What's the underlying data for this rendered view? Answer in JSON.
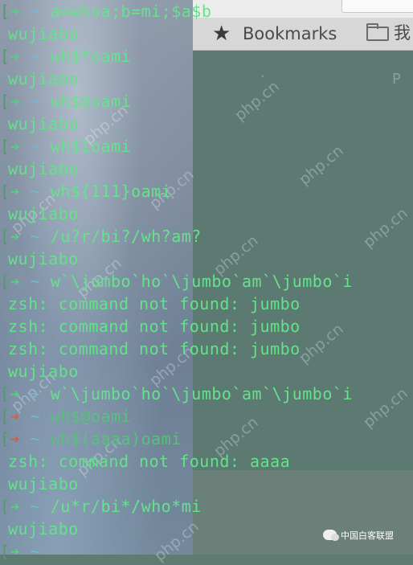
{
  "browser": {
    "bookmarks_label": "Bookmarks",
    "folder_label": "我"
  },
  "watermark": "php.cn",
  "badge": "中国白客联盟",
  "colors": {
    "prompt_arrow_ok": "#57d27a",
    "prompt_arrow_error": "#d35d4a",
    "tilde": "#6fb9d8",
    "output": "#63e28a"
  },
  "terminal": {
    "lines": [
      {
        "kind": "prompt",
        "status": "ok",
        "cmd": "a=whoa;b=mi;$a$b"
      },
      {
        "kind": "output",
        "text": "wujiabo"
      },
      {
        "kind": "prompt",
        "status": "ok",
        "cmd": "wh$*oami"
      },
      {
        "kind": "output",
        "text": "wujiabo"
      },
      {
        "kind": "prompt",
        "status": "ok",
        "cmd": "wh$@oami"
      },
      {
        "kind": "output",
        "text": "wujiabo"
      },
      {
        "kind": "prompt",
        "status": "ok",
        "cmd": "wh$1oami"
      },
      {
        "kind": "output",
        "text": "wujiabo"
      },
      {
        "kind": "prompt",
        "status": "ok",
        "cmd": "wh${111}oami"
      },
      {
        "kind": "output",
        "text": "wujiabo"
      },
      {
        "kind": "prompt",
        "status": "ok",
        "cmd": "/u?r/bi?/wh?am?"
      },
      {
        "kind": "output",
        "text": "wujiabo"
      },
      {
        "kind": "prompt",
        "status": "ok",
        "cmd": "w`\\jumbo`ho`\\jumbo`am`\\jumbo`i"
      },
      {
        "kind": "output",
        "text": "zsh: command not found: jumbo"
      },
      {
        "kind": "output",
        "text": "zsh: command not found: jumbo"
      },
      {
        "kind": "output",
        "text": "zsh: command not found: jumbo"
      },
      {
        "kind": "output",
        "text": "wujiabo"
      },
      {
        "kind": "prompt",
        "status": "ok",
        "cmd": "w`\\jumbo`ho`\\jumbo`am`\\jumbo`i"
      },
      {
        "kind": "prompt",
        "status": "error",
        "cmd": "wh$@oami"
      },
      {
        "kind": "prompt",
        "status": "error",
        "cmd": "wh$(aaaa)oami"
      },
      {
        "kind": "output",
        "text": "zsh: command not found: aaaa"
      },
      {
        "kind": "output",
        "text": "wujiabo"
      },
      {
        "kind": "prompt",
        "status": "ok",
        "cmd": "/u*r/bi*/who*mi"
      },
      {
        "kind": "output",
        "text": "wujiabo"
      },
      {
        "kind": "prompt",
        "status": "ok",
        "cmd": ""
      }
    ]
  }
}
